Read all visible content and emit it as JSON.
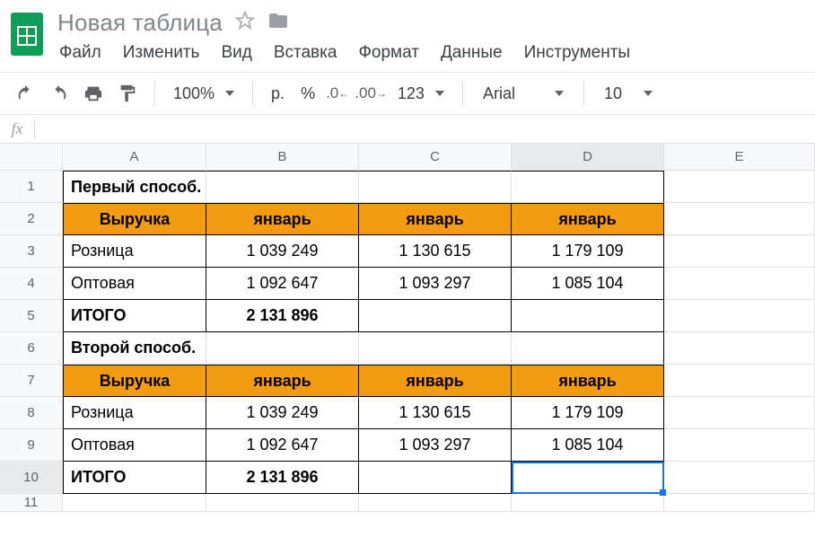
{
  "doc": {
    "title": "Новая таблица"
  },
  "menu": {
    "file": "Файл",
    "edit": "Изменить",
    "view": "Вид",
    "insert": "Вставка",
    "format": "Формат",
    "data": "Данные",
    "tools": "Инструменты"
  },
  "toolbar": {
    "zoom": "100%",
    "currency": "р.",
    "percent": "%",
    "dec_dec": ".0",
    "dec_inc": ".00",
    "num_fmt": "123",
    "font": "Arial",
    "size": "10"
  },
  "fx": {
    "label": "fx"
  },
  "columns": [
    "A",
    "B",
    "C",
    "D",
    "E"
  ],
  "rows": [
    "1",
    "2",
    "3",
    "4",
    "5",
    "6",
    "7",
    "8",
    "9",
    "10",
    "11"
  ],
  "selected_cell": "D10",
  "sheet": {
    "r1": {
      "A": "Первый способ."
    },
    "r2": {
      "A": "Выручка",
      "B": "январь",
      "C": "январь",
      "D": "январь"
    },
    "r3": {
      "A": "Розница",
      "B": "1 039 249",
      "C": "1 130 615",
      "D": "1 179 109"
    },
    "r4": {
      "A": "Оптовая",
      "B": "1 092 647",
      "C": "1 093 297",
      "D": "1 085 104"
    },
    "r5": {
      "A": "ИТОГО",
      "B": "2 131 896"
    },
    "r6": {
      "A": "Второй способ."
    },
    "r7": {
      "A": "Выручка",
      "B": "январь",
      "C": "январь",
      "D": "январь"
    },
    "r8": {
      "A": "Розница",
      "B": "1 039 249",
      "C": "1 130 615",
      "D": "1 179 109"
    },
    "r9": {
      "A": "Оптовая",
      "B": "1 092 647",
      "C": "1 093 297",
      "D": "1 085 104"
    },
    "r10": {
      "A": "ИТОГО",
      "B": "2 131 896"
    }
  }
}
